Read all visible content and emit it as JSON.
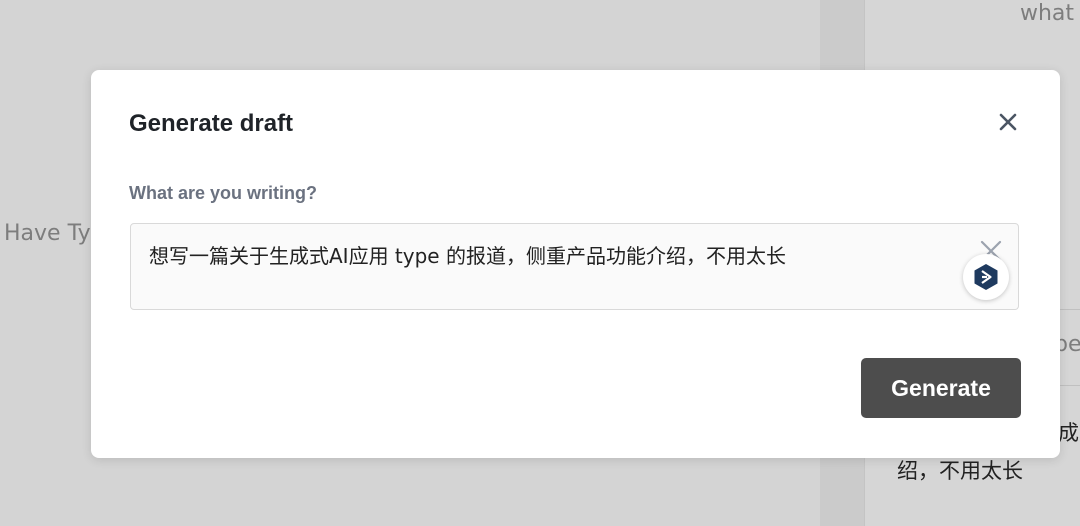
{
  "background": {
    "left_fragment": "Have Ty",
    "top_right_fragment": "what",
    "panel_fragment_1": "pe",
    "panel_fragment_2": "成",
    "panel_fragment_3": "绍，不用太长"
  },
  "modal": {
    "title": "Generate draft",
    "close_icon": "close-icon",
    "field_label": "What are you writing?",
    "prompt_value": "想写一篇关于生成式AI应用 type 的报道，侧重产品功能介绍，不用太长",
    "clear_icon": "clear-icon",
    "assistant_icon": "assistant-logo-icon",
    "generate_label": "Generate"
  },
  "colors": {
    "overlay_bg": "#d6d6d6",
    "modal_bg": "#ffffff",
    "button_bg": "#4d4d4d",
    "label_color": "#6b7280",
    "assistant_icon_color": "#1e3a5f"
  }
}
